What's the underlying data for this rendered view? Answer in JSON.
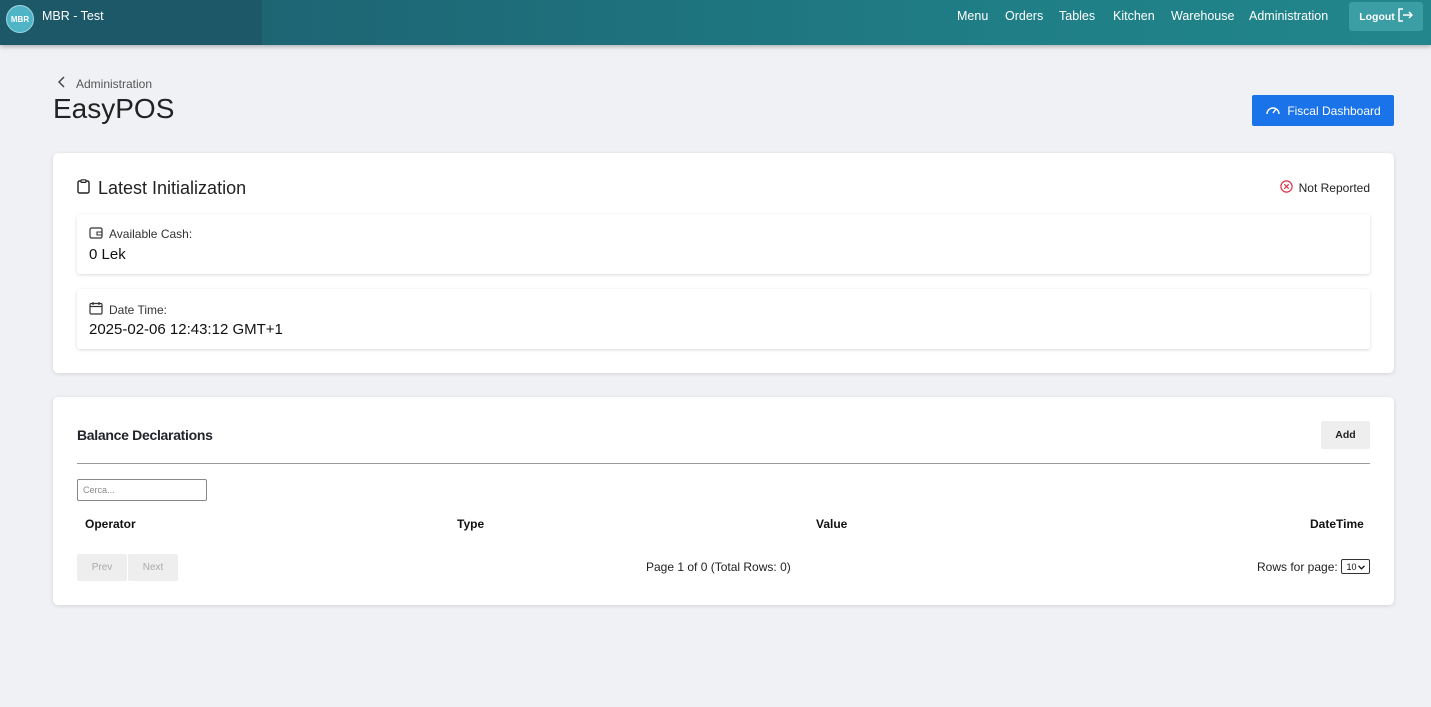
{
  "app": {
    "logo_text": "MBR",
    "title": "MBR - Test"
  },
  "nav": {
    "items": [
      "Menu",
      "Orders",
      "Tables",
      "Kitchen",
      "Warehouse",
      "Administration"
    ],
    "logout_label": "Logout"
  },
  "header": {
    "breadcrumb": "Administration",
    "title": "EasyPOS",
    "fiscal_button": "Fiscal Dashboard"
  },
  "initialization": {
    "title": "Latest Initialization",
    "status": "Not Reported",
    "status_color": "#dc3545",
    "cash_label": "Available Cash:",
    "cash_value": "0 Lek",
    "datetime_label": "Date Time:",
    "datetime_value": "2025-02-06 12:43:12 GMT+1"
  },
  "balance": {
    "title": "Balance Declarations",
    "add_label": "Add",
    "search_placeholder": "Cerca...",
    "columns": [
      "Operator",
      "Type",
      "Value",
      "DateTime"
    ],
    "prev_label": "Prev",
    "next_label": "Next",
    "page_info": "Page 1 of 0 (Total Rows: 0)",
    "rows_label": "Rows for page:",
    "rows_value": "10"
  },
  "colors": {
    "navbar": "#1f7e86",
    "primary_button": "#1a73e8"
  }
}
